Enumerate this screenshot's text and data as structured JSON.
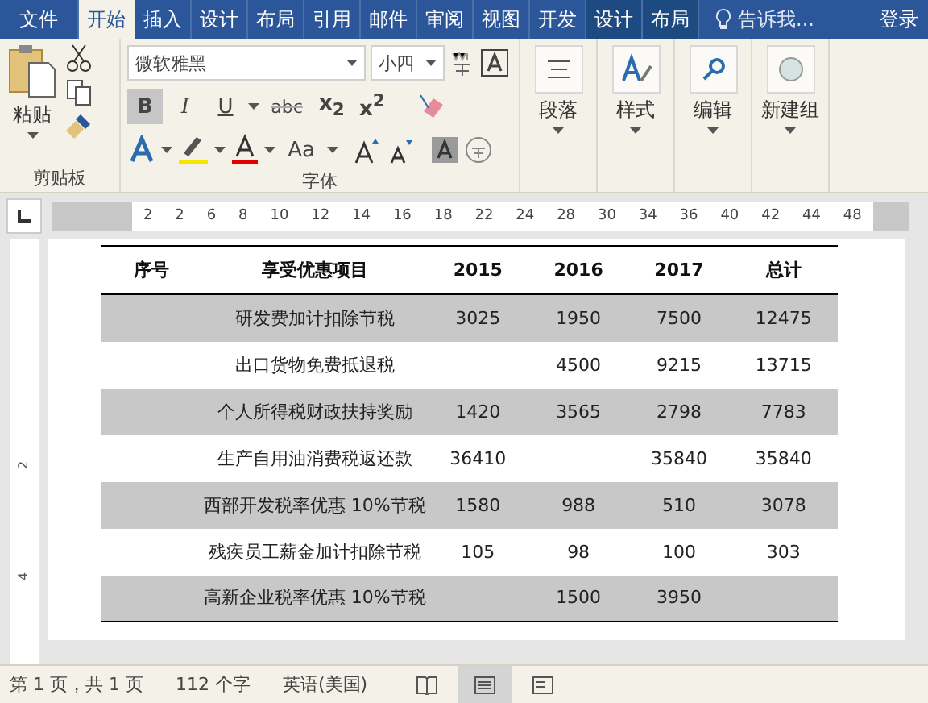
{
  "tabs": [
    {
      "label": "文件",
      "selected": false,
      "kind": "file"
    },
    {
      "label": "开始",
      "selected": true,
      "kind": "normal"
    },
    {
      "label": "插入",
      "selected": false,
      "kind": "normal"
    },
    {
      "label": "设计",
      "selected": false,
      "kind": "normal"
    },
    {
      "label": "布局",
      "selected": false,
      "kind": "normal"
    },
    {
      "label": "引用",
      "selected": false,
      "kind": "normal"
    },
    {
      "label": "邮件",
      "selected": false,
      "kind": "normal"
    },
    {
      "label": "审阅",
      "selected": false,
      "kind": "normal"
    },
    {
      "label": "视图",
      "selected": false,
      "kind": "normal"
    },
    {
      "label": "开发",
      "selected": false,
      "kind": "normal"
    },
    {
      "label": "设计",
      "selected": false,
      "kind": "context"
    },
    {
      "label": "布局",
      "selected": false,
      "kind": "context"
    }
  ],
  "tell_me": "告诉我...",
  "sign_in": "登录",
  "ribbon": {
    "paste": "粘贴",
    "clipboard_group": "剪贴板",
    "font_name": "微软雅黑",
    "font_size": "小四",
    "format_buttons": [
      {
        "label": "B",
        "kind": "bold",
        "on": true
      },
      {
        "label": "I",
        "kind": "italic",
        "on": false
      },
      {
        "label": "U",
        "kind": "underline",
        "on": false
      },
      {
        "label": "abc",
        "kind": "strike",
        "on": false
      },
      {
        "label": "x$_{2}$",
        "kind": "sub",
        "on": false
      },
      {
        "label": "x$^{2}$",
        "kind": "sup",
        "on": false
      }
    ],
    "change_case": "Aa",
    "font_group": "字体",
    "big_buttons": [
      {
        "label": "段落",
        "kind": "paragraph"
      },
      {
        "label": "样式",
        "kind": "styles"
      },
      {
        "label": "编辑",
        "kind": "editing"
      },
      {
        "label": "新建组",
        "kind": "newgroup"
      }
    ]
  },
  "ruler": [
    "2",
    "2",
    "6",
    "8",
    "10",
    "12",
    "14",
    "16",
    "18",
    "22",
    "24",
    "28",
    "30",
    "34",
    "36",
    "40",
    "42",
    "44",
    "48"
  ],
  "vertical_ruler": [
    "2",
    "4"
  ],
  "table": {
    "columns": [
      "序号",
      "享受优惠项目",
      "2015",
      "2016",
      "2017",
      "总计"
    ],
    "rows": [
      {
        "shaded": true,
        "cells": [
          "",
          "研发费加计扣除节税",
          "3025",
          "1950",
          "7500",
          "12475"
        ]
      },
      {
        "shaded": false,
        "cells": [
          "",
          "出口货物免费抵退税",
          "",
          "4500",
          "9215",
          "13715"
        ]
      },
      {
        "shaded": true,
        "cells": [
          "",
          "个人所得税财政扶持奖励",
          "1420",
          "3565",
          "2798",
          "7783"
        ]
      },
      {
        "shaded": false,
        "cells": [
          "",
          "生产自用油消费税返还款",
          "36410",
          "",
          "35840",
          "35840"
        ]
      },
      {
        "shaded": true,
        "cells": [
          "",
          "西部开发税率优惠 10%节税",
          "1580",
          "988",
          "510",
          "3078"
        ]
      },
      {
        "shaded": false,
        "cells": [
          "",
          "残疾员工薪金加计扣除节税",
          "105",
          "98",
          "100",
          "303"
        ]
      },
      {
        "shaded": true,
        "cells": [
          "",
          "高新企业税率优惠 10%节税",
          "",
          "1500",
          "3950",
          ""
        ]
      }
    ]
  },
  "status_bar": {
    "page": "第 1 页，共 1 页",
    "words": "112 个字",
    "language": "英语(美国)"
  }
}
